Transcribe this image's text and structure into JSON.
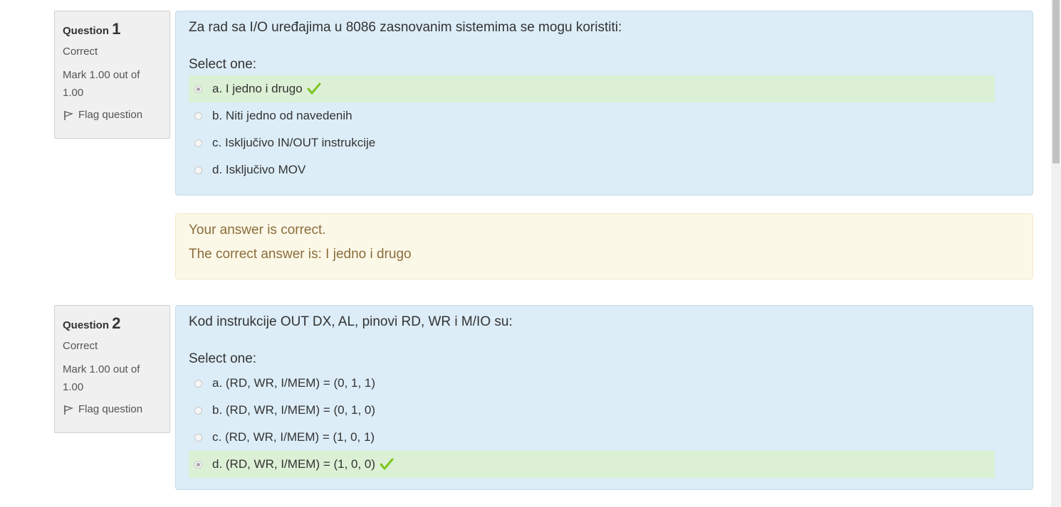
{
  "questions": [
    {
      "label": "Question",
      "number": "1",
      "state": "Correct",
      "grade": "Mark 1.00 out of 1.00",
      "flag": "Flag question",
      "text": "Za rad sa I/O uređajima u 8086 zasnovanim sistemima se mogu koristiti:",
      "prompt": "Select one:",
      "options": [
        {
          "label": "a. I jedno i drugo",
          "checked": true,
          "correct": true
        },
        {
          "label": "b. Niti jedno od navedenih",
          "checked": false,
          "correct": false
        },
        {
          "label": "c. Isključivo IN/OUT instrukcije",
          "checked": false,
          "correct": false
        },
        {
          "label": "d. Isključivo MOV",
          "checked": false,
          "correct": false
        }
      ],
      "feedback": {
        "result": "Your answer is correct.",
        "right_answer": "The correct answer is: I jedno i drugo"
      }
    },
    {
      "label": "Question",
      "number": "2",
      "state": "Correct",
      "grade": "Mark 1.00 out of 1.00",
      "flag": "Flag question",
      "text": "Kod instrukcije OUT DX, AL, pinovi RD, WR i M/IO su:",
      "prompt": "Select one:",
      "options": [
        {
          "label": "a. (RD, WR, I/MEM) = (0, 1, 1)",
          "checked": false,
          "correct": false
        },
        {
          "label": "b. (RD, WR, I/MEM) = (0, 1, 0)",
          "checked": false,
          "correct": false
        },
        {
          "label": "c. (RD, WR, I/MEM) = (1, 0, 1)",
          "checked": false,
          "correct": false
        },
        {
          "label": "d. (RD, WR, I/MEM) = (1, 0, 0)",
          "checked": true,
          "correct": true
        }
      ]
    }
  ],
  "icons": {
    "flag": "flag-icon",
    "check": "checkmark-icon"
  },
  "colors": {
    "correct_bg": "#dcf0d5",
    "formulation_bg": "#dcedf7",
    "feedback_bg": "#fcf8e8",
    "check": "#7cc520"
  }
}
